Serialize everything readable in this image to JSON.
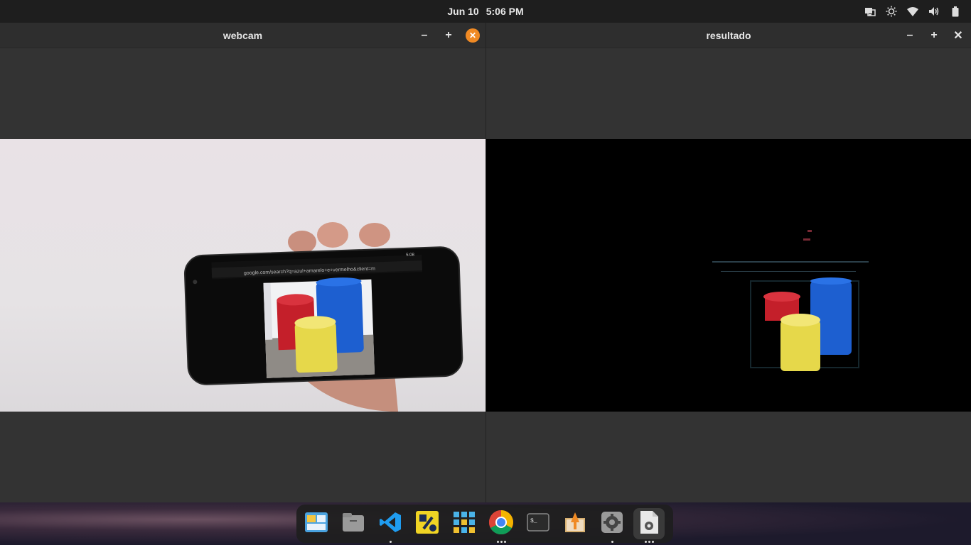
{
  "topbar": {
    "date": "Jun 10",
    "time": "5:06 PM",
    "tray_icons": [
      "screen-share-icon",
      "brightness-icon",
      "wifi-icon",
      "volume-icon",
      "battery-icon"
    ]
  },
  "windows": [
    {
      "title": "webcam",
      "buttons": [
        "–",
        "+",
        "✕"
      ]
    },
    {
      "title": "resultado",
      "buttons": [
        "–",
        "+",
        "✕"
      ]
    }
  ],
  "phone_screen": {
    "url_text": "google.com/search?q=azul+amarelo+e+vermelho&client=m",
    "clock": "5:08"
  },
  "dock": {
    "apps": [
      {
        "name": "workspaces-icon",
        "running": false
      },
      {
        "name": "files-icon",
        "running": false
      },
      {
        "name": "vscode-icon",
        "running": true,
        "windows": 1
      },
      {
        "name": "settings-tool-icon",
        "running": false
      },
      {
        "name": "app-grid-icon",
        "running": false
      },
      {
        "name": "chrome-icon",
        "running": true,
        "windows": 3
      },
      {
        "name": "terminal-icon",
        "running": false
      },
      {
        "name": "installer-icon",
        "running": false
      },
      {
        "name": "system-settings-icon",
        "running": true,
        "windows": 1
      },
      {
        "name": "python-script-icon",
        "running": true,
        "windows": 3
      }
    ]
  },
  "colors": {
    "accent_close": "#f08a24",
    "topbar_bg": "#1e1e1e",
    "window_bg": "#333333"
  }
}
